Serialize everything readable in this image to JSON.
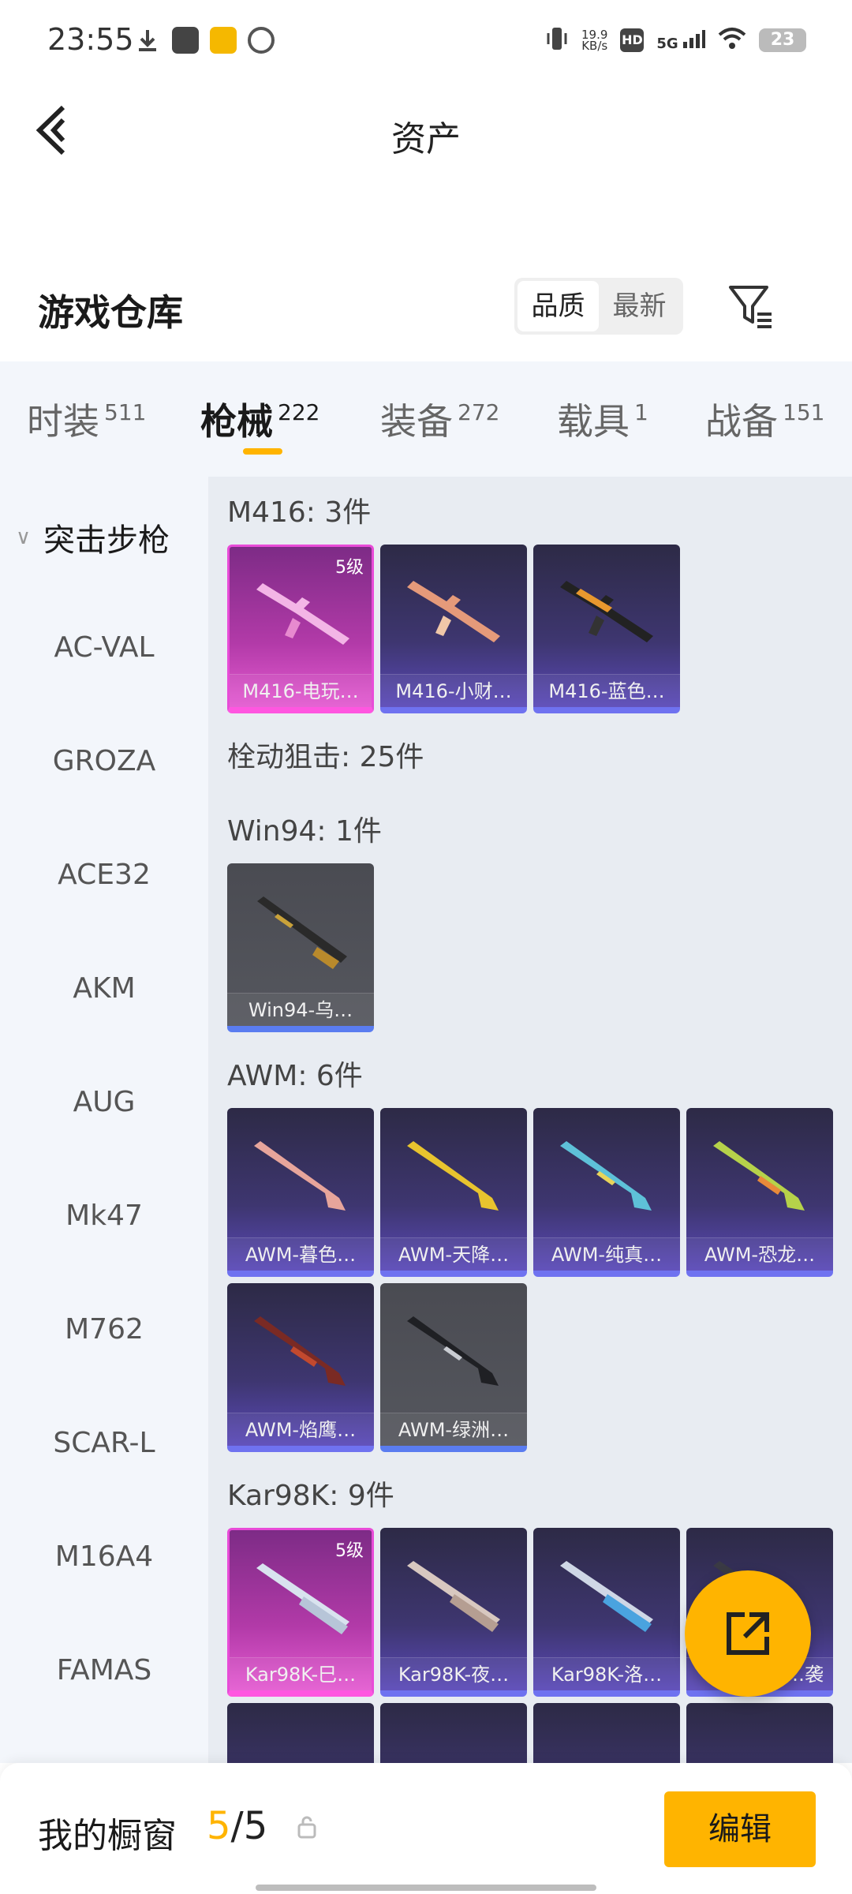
{
  "status": {
    "time": "23:55",
    "net_speed": "19.9",
    "net_unit": "KB/s",
    "battery": "23",
    "signal": "5G",
    "hd": "HD"
  },
  "header": {
    "title": "资产"
  },
  "warehouse": {
    "title": "游戏仓库",
    "sort_quality": "品质",
    "sort_latest": "最新"
  },
  "tabs": [
    {
      "label": "时装",
      "count": "511"
    },
    {
      "label": "枪械",
      "count": "222"
    },
    {
      "label": "装备",
      "count": "272"
    },
    {
      "label": "载具",
      "count": "1"
    },
    {
      "label": "战备",
      "count": "151"
    }
  ],
  "sidebar": {
    "group": "突击步枪",
    "items": [
      "AC-VAL",
      "GROZA",
      "ACE32",
      "AKM",
      "AUG",
      "Mk47",
      "M762",
      "SCAR-L",
      "M16A4",
      "FAMAS"
    ]
  },
  "groups": {
    "m416": "M416: 3件",
    "bolt": "栓动狙击: 25件",
    "win94": "Win94: 1件",
    "awm": "AWM: 6件",
    "kar98k": "Kar98K: 9件"
  },
  "cards": {
    "m416_1": {
      "name": "M416-电玩…",
      "level": "5级"
    },
    "m416_2": {
      "name": "M416-小财…"
    },
    "m416_3": {
      "name": "M416-蓝色…"
    },
    "win94_1": {
      "name": "Win94-乌…"
    },
    "awm_1": {
      "name": "AWM-暮色…"
    },
    "awm_2": {
      "name": "AWM-天降…"
    },
    "awm_3": {
      "name": "AWM-纯真…"
    },
    "awm_4": {
      "name": "AWM-恐龙…"
    },
    "awm_5": {
      "name": "AWM-焰鹰…"
    },
    "awm_6": {
      "name": "AWM-绿洲…"
    },
    "kar_1": {
      "name": "Kar98K-巳…",
      "level": "5级"
    },
    "kar_2": {
      "name": "Kar98K-夜…"
    },
    "kar_3": {
      "name": "Kar98K-洛…"
    },
    "kar_4": {
      "name": "…袭"
    }
  },
  "bottom": {
    "title": "我的橱窗",
    "count_current": "5",
    "count_sep_total": "/5",
    "edit_label": "编辑"
  },
  "colors": {
    "accent": "#ffb400",
    "purple_rarity": "#6f72f0",
    "pink_rarity": "#ff56e0"
  }
}
